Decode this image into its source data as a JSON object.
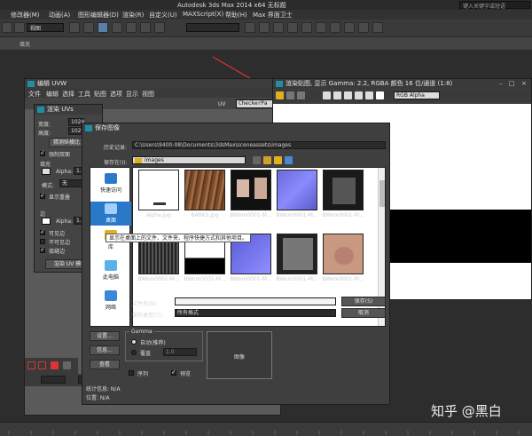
{
  "app": {
    "title": "Autodesk 3ds Max  2014 x64      无标题",
    "search_placeholder": "键入关键字或短语"
  },
  "menubar": {
    "items": [
      "修改器(M)",
      "动画(A)",
      "图形编辑器(D)",
      "渲染(R)",
      "自定义(U)",
      "MAXScript(X)",
      "帮助(H)",
      "Max 界面卫士"
    ]
  },
  "toolbar": {
    "view_select": "视图"
  },
  "ribbon": {
    "label": "填充"
  },
  "uvw_window": {
    "title": "编辑 UVW",
    "menu": [
      "文件",
      "编辑",
      "选择",
      "工具",
      "贴图",
      "选项",
      "显示",
      "视图"
    ],
    "uv_label": "UV",
    "checker_label": "CheckerPa"
  },
  "render_uvs": {
    "title": "渲染 UVs",
    "width_label": "宽度:",
    "width_value": "1024",
    "height_label": "高度:",
    "height_value": "1024",
    "guess_ratio": "猜测纵横比",
    "force2sided": "强制双面",
    "fill_label": "填充",
    "alpha_label": "Alpha:",
    "alpha_value": "1.0",
    "mode_label": "模式:",
    "mode_value": "无",
    "show_overlap": "显示重叠",
    "edge_label": "边",
    "edge_alpha_label": "Alpha:",
    "edge_alpha_value": "1.0",
    "visible_edges": "可见边",
    "invisible_edges": "不可见边",
    "seam_edges": "接缝边",
    "render_button": "渲染 UV 模板"
  },
  "render_frame": {
    "title": "渲染贴图, 显示 Gamma: 2.2, RGBA 颜色 16 位/通道 (1:8)",
    "channel": "RGB Alpha"
  },
  "save_dialog": {
    "title": "保存图像",
    "history_label": "历史记录:",
    "history_value": "C:\\Users\\9400-08\\Documents\\3dsMax\\sceneassets\\images",
    "savein_label": "保存在(I):",
    "savein_value": "images",
    "places": [
      {
        "label": "快速访问"
      },
      {
        "label": "桌面"
      },
      {
        "label": "库"
      },
      {
        "label": "此电脑"
      },
      {
        "label": "网络"
      }
    ],
    "files_row1": [
      "alpha.jpg",
      "BARKS.jpg",
      "BWom0001-M...",
      "BWom0001-M...",
      "BWom0001-M..."
    ],
    "files_row2": [
      "BWom0001-M...",
      "BWom0001-M...",
      "BWom0001-M...",
      "BWom0001-M...",
      "BWom0001-M..."
    ],
    "tooltip": "显示在桌面上的文件、文件夹、程序快捷方式和其他项目。",
    "filename_label": "文件名(N):",
    "filename_value": "",
    "filetype_label": "保存类型(T):",
    "filetype_value": "所有格式",
    "save_button": "保存(S)",
    "cancel_button": "取消",
    "setup_button": "设置...",
    "info_button": "信息...",
    "view_button": "查看",
    "gamma_label": "Gamma",
    "gamma_auto": "自动(推荐)",
    "gamma_override": "覆盖",
    "gamma_value": "1.0",
    "sequence_label": "序列",
    "preview_label": "预览",
    "image_label": "图像",
    "stats_label": "统计信息: N/A",
    "location_label": "位置: N/A"
  },
  "watermark": "知乎 @黑白"
}
